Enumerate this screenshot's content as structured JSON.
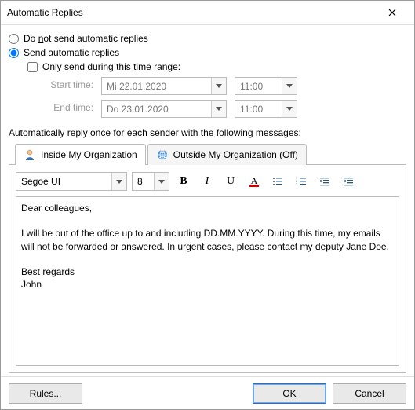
{
  "window": {
    "title": "Automatic Replies"
  },
  "options": {
    "do_not_send": "Do not send automatic replies",
    "send": "Send automatic replies",
    "only_send_range": "Only send during this time range:"
  },
  "time": {
    "start_label": "Start time:",
    "end_label": "End time:",
    "start_date": "Mi 22.01.2020",
    "end_date": "Do 23.01.2020",
    "start_time": "11:00",
    "end_time": "11:00"
  },
  "section_text": "Automatically reply once for each sender with the following messages:",
  "tabs": {
    "inside": "Inside My Organization",
    "outside": "Outside My Organization (Off)"
  },
  "toolbar": {
    "font": "Segoe UI",
    "size": "8"
  },
  "message": "Dear colleagues,\n\nI will be out of the office up to and including DD.MM.YYYY. During this time, my emails will not be forwarded or answered. In urgent cases, please contact my deputy Jane Doe.\n\nBest regards\nJohn",
  "footer": {
    "rules": "Rules...",
    "ok": "OK",
    "cancel": "Cancel"
  }
}
